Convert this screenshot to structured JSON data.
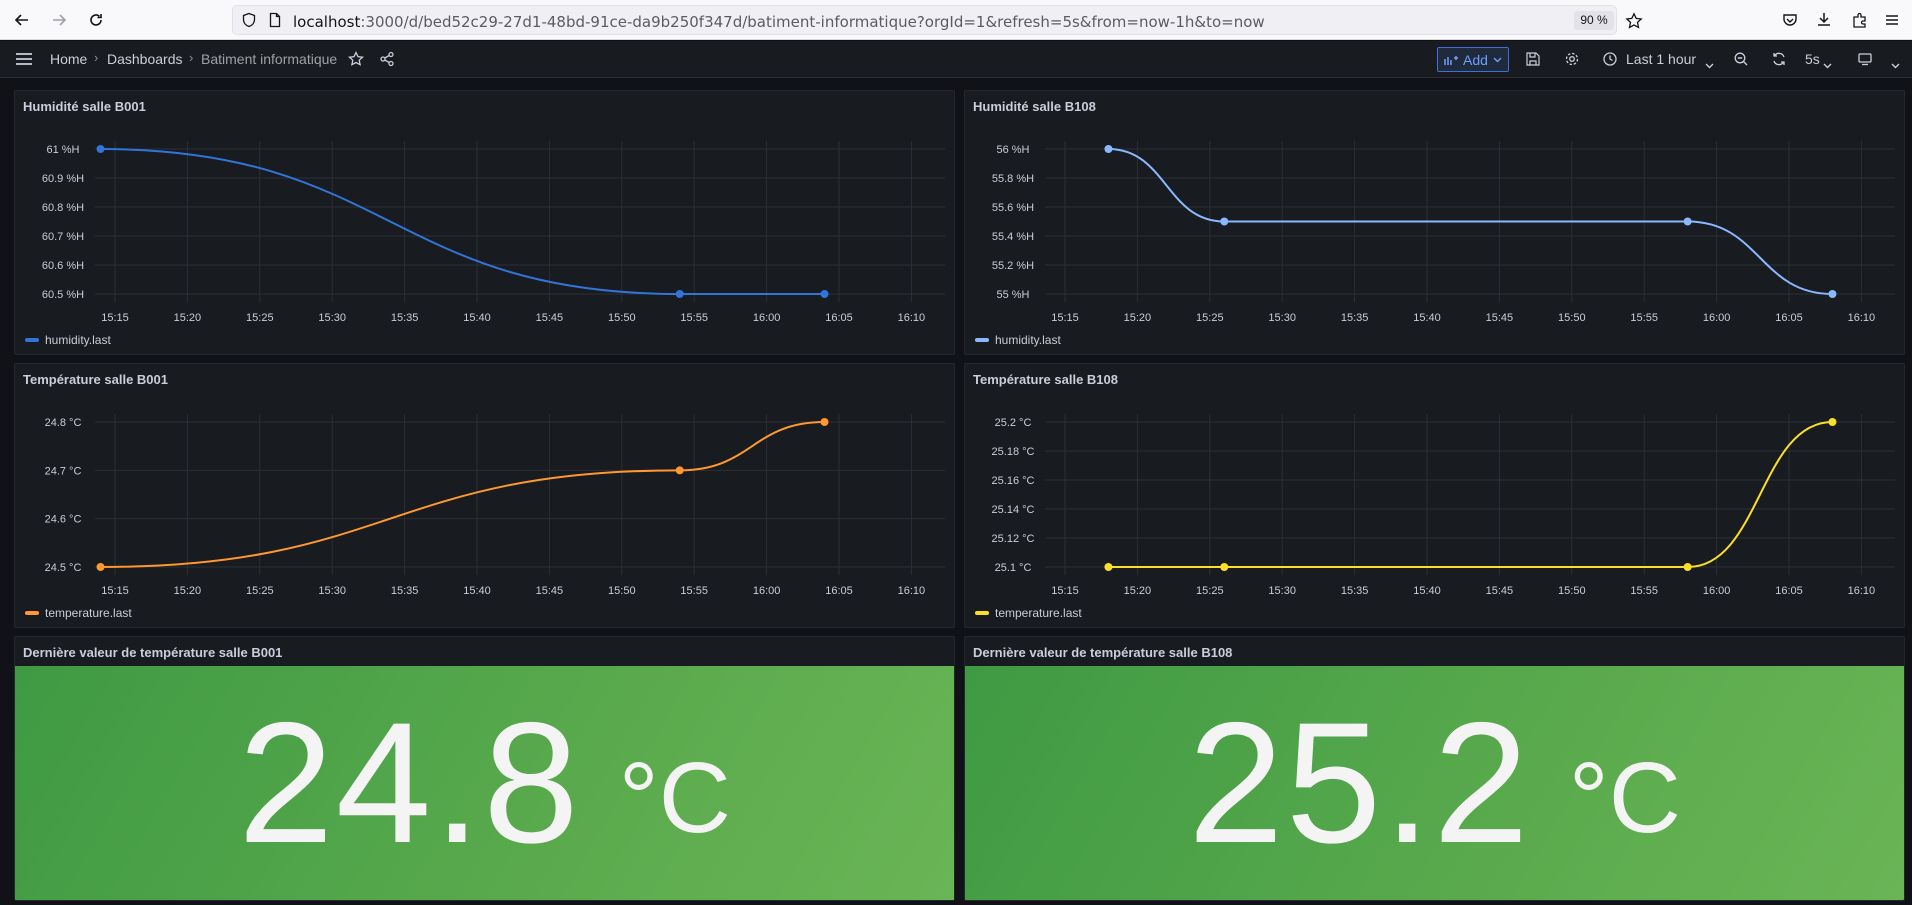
{
  "browser": {
    "url_host": "localhost",
    "url_rest": ":3000/d/bed52c29-27d1-48bd-91ce-da9b250f347d/batiment-informatique?orgId=1&refresh=5s&from=now-1h&to=now",
    "zoom": "90 %"
  },
  "header": {
    "breadcrumb": [
      "Home",
      "Dashboards",
      "Batiment informatique"
    ],
    "add_label": "Add",
    "time_range": "Last 1 hour",
    "refresh": "5s"
  },
  "panels": {
    "hum_b001": {
      "title": "Humidité salle B001",
      "legend": "humidity.last"
    },
    "hum_b108": {
      "title": "Humidité salle B108",
      "legend": "humidity.last"
    },
    "temp_b001": {
      "title": "Température salle B001",
      "legend": "temperature.last"
    },
    "temp_b108": {
      "title": "Température salle B108",
      "legend": "temperature.last"
    },
    "stat_b001": {
      "title": "Dernière valeur de température salle B001",
      "value": "24.8",
      "unit": "°C"
    },
    "stat_b108": {
      "title": "Dernière valeur de température salle B108",
      "value": "25.2",
      "unit": "°C"
    }
  },
  "colors": {
    "humidity_b001": "#3274d9",
    "humidity_b108": "#8ab8ff",
    "temp_b001": "#ff9830",
    "temp_b108": "#fade2a",
    "stat_green": "#56a64b"
  },
  "chart_data": [
    {
      "id": "hum_b001",
      "type": "line",
      "title": "Humidité salle B001",
      "x_ticks": [
        "15:15",
        "15:20",
        "15:25",
        "15:30",
        "15:35",
        "15:40",
        "15:45",
        "15:50",
        "15:55",
        "16:00",
        "16:05",
        "16:10"
      ],
      "y_ticks": [
        "61 %H",
        "60.9 %H",
        "60.8 %H",
        "60.7 %H",
        "60.6 %H",
        "60.5 %H"
      ],
      "ylim": [
        60.5,
        61
      ],
      "series": [
        {
          "name": "humidity.last",
          "points": [
            [
              "15:14",
              61
            ],
            [
              "15:54",
              60.5
            ],
            [
              "16:04",
              60.5
            ]
          ]
        }
      ]
    },
    {
      "id": "hum_b108",
      "type": "line",
      "title": "Humidité salle B108",
      "x_ticks": [
        "15:15",
        "15:20",
        "15:25",
        "15:30",
        "15:35",
        "15:40",
        "15:45",
        "15:50",
        "15:55",
        "16:00",
        "16:05",
        "16:10"
      ],
      "y_ticks": [
        "56 %H",
        "55.8 %H",
        "55.6 %H",
        "55.4 %H",
        "55.2 %H",
        "55 %H"
      ],
      "ylim": [
        55,
        56
      ],
      "series": [
        {
          "name": "humidity.last",
          "points": [
            [
              "15:18",
              56
            ],
            [
              "15:26",
              55.5
            ],
            [
              "15:58",
              55.5
            ],
            [
              "16:08",
              55
            ]
          ]
        }
      ]
    },
    {
      "id": "temp_b001",
      "type": "line",
      "title": "Température salle B001",
      "x_ticks": [
        "15:15",
        "15:20",
        "15:25",
        "15:30",
        "15:35",
        "15:40",
        "15:45",
        "15:50",
        "15:55",
        "16:00",
        "16:05",
        "16:10"
      ],
      "y_ticks": [
        "24.8 °C",
        "24.7 °C",
        "24.6 °C",
        "24.5 °C"
      ],
      "ylim": [
        24.5,
        24.8
      ],
      "series": [
        {
          "name": "temperature.last",
          "points": [
            [
              "15:14",
              24.5
            ],
            [
              "15:54",
              24.7
            ],
            [
              "16:04",
              24.8
            ]
          ]
        }
      ]
    },
    {
      "id": "temp_b108",
      "type": "line",
      "title": "Température salle B108",
      "x_ticks": [
        "15:15",
        "15:20",
        "15:25",
        "15:30",
        "15:35",
        "15:40",
        "15:45",
        "15:50",
        "15:55",
        "16:00",
        "16:05",
        "16:10"
      ],
      "y_ticks": [
        "25.2 °C",
        "25.18 °C",
        "25.16 °C",
        "25.14 °C",
        "25.12 °C",
        "25.1 °C"
      ],
      "ylim": [
        25.1,
        25.2
      ],
      "series": [
        {
          "name": "temperature.last",
          "points": [
            [
              "15:18",
              25.1
            ],
            [
              "15:26",
              25.1
            ],
            [
              "15:58",
              25.1
            ],
            [
              "16:08",
              25.2
            ]
          ]
        }
      ]
    }
  ]
}
